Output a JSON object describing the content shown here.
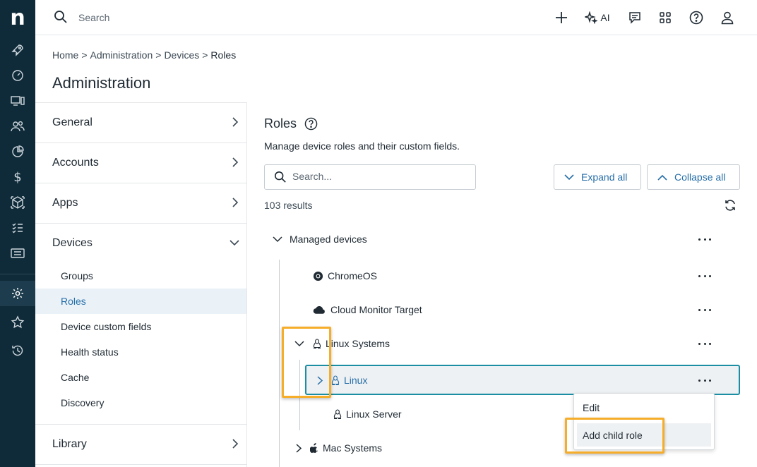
{
  "app": {
    "logo_letter": "n"
  },
  "topbar": {
    "search_placeholder": "Search",
    "ai_label": "AI"
  },
  "breadcrumb": {
    "items": [
      "Home",
      "Administration",
      "Devices",
      "Roles"
    ],
    "separator": ">"
  },
  "page": {
    "title": "Administration"
  },
  "adminnav": {
    "sections": [
      "General",
      "Accounts",
      "Apps",
      "Devices",
      "Library"
    ],
    "devices_items": [
      "Groups",
      "Roles",
      "Device custom fields",
      "Health status",
      "Cache",
      "Discovery"
    ],
    "active_item": "Roles"
  },
  "roles": {
    "title": "Roles",
    "description": "Manage device roles and their custom fields.",
    "search_placeholder": "Search...",
    "expand_all": "Expand all",
    "collapse_all": "Collapse all",
    "results": "103 results"
  },
  "tree": {
    "managed_devices": "Managed devices",
    "chromeos": "ChromeOS",
    "cloud_monitor": "Cloud Monitor Target",
    "linux_systems": "Linux Systems",
    "linux": "Linux",
    "linux_server": "Linux Server",
    "mac_systems": "Mac Systems"
  },
  "context_menu": {
    "edit": "Edit",
    "add_child_role": "Add child role"
  },
  "colors": {
    "rail_bg": "#0f2b3a",
    "accent": "#266ea8",
    "selected_border": "#1b8ea3",
    "highlight": "#f5ad2a"
  }
}
